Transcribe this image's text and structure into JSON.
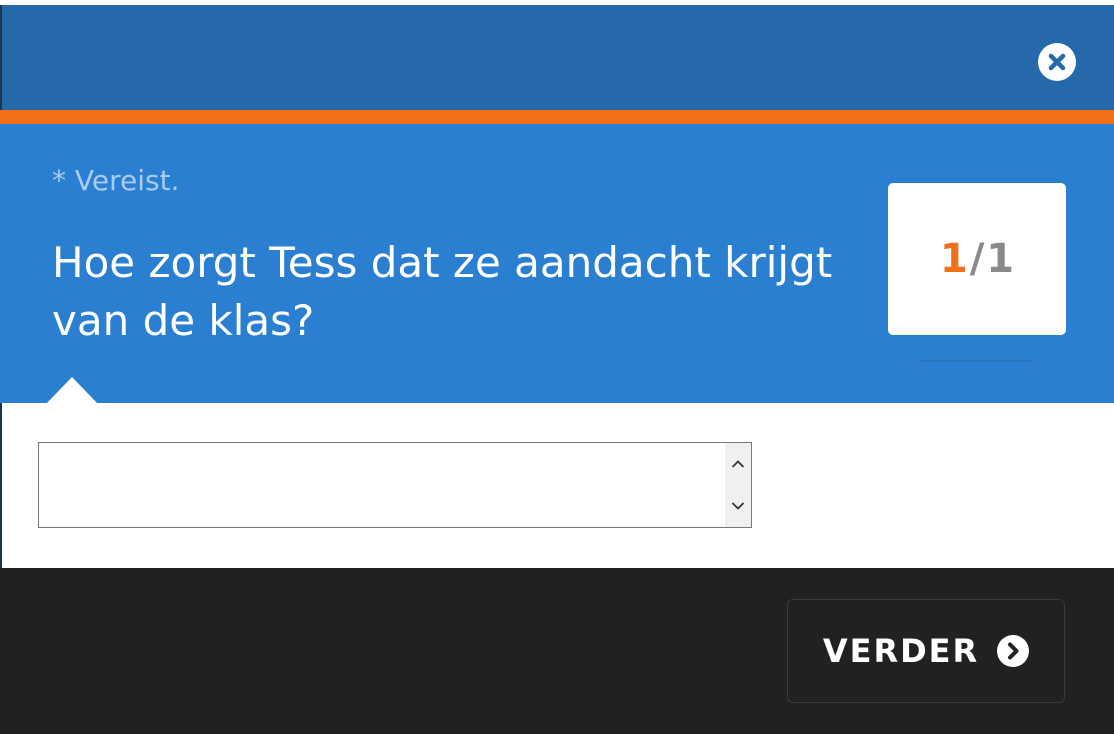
{
  "dialog": {
    "close_icon": "close-circle-icon"
  },
  "question": {
    "required_note": "* Vereist.",
    "text": "Hoe zorgt Tess dat ze aandacht krijgt van de klas?"
  },
  "progress": {
    "current": "1",
    "separator": "/",
    "total": "1"
  },
  "answer": {
    "value": "",
    "placeholder": "",
    "spinner_up_icon": "chevron-up-icon",
    "spinner_down_icon": "chevron-down-icon"
  },
  "footer": {
    "next_label": "VERDER",
    "next_icon": "chevron-right-circle-icon"
  },
  "colors": {
    "header": "#2669aa",
    "accent": "#f26f1a",
    "panel": "#2a7fd0",
    "footer": "#212121"
  }
}
